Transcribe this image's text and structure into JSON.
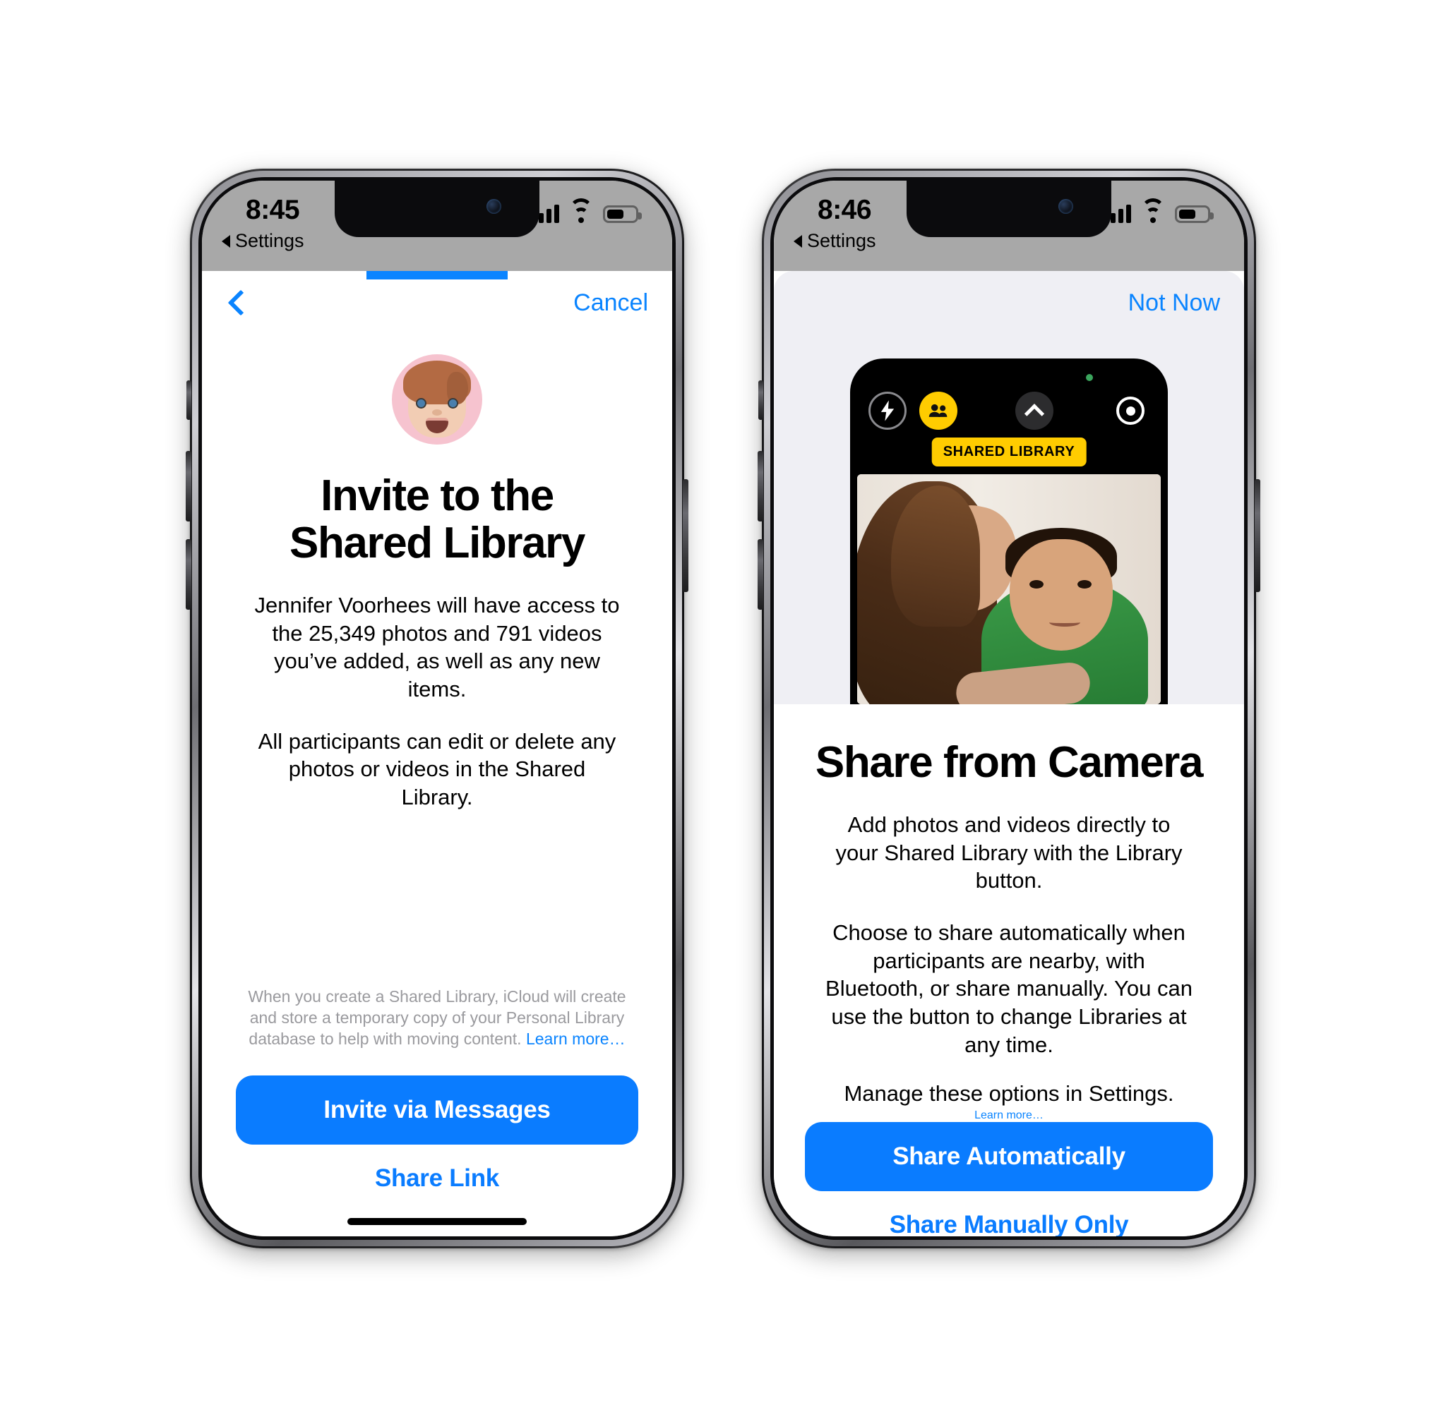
{
  "left_phone": {
    "status_bar": {
      "time": "8:45",
      "back_label": "Settings",
      "signal_icon": "cellular-signal-icon",
      "wifi_icon": "wifi-icon",
      "battery_icon": "battery-icon"
    },
    "nav": {
      "back_icon": "chevron-left-icon",
      "cancel_label": "Cancel"
    },
    "avatar": {
      "name": "memoji-avatar",
      "background_color": "#f6c3cf"
    },
    "title": "Invite to the\nShared Library",
    "title_line1": "Invite to the",
    "title_line2": "Shared Library",
    "paragraph_1": "Jennifer Voorhees will have access to the 25,349 photos and 791 videos you’ve added, as well as any new items.",
    "paragraph_2": "All participants can edit or delete any photos or videos in the Shared Library.",
    "disclaimer": "When you create a Shared Library, iCloud will create and store a temporary copy of your Personal Library database to help with moving content. ",
    "disclaimer_link": "Learn more…",
    "primary_button": "Invite via Messages",
    "secondary_button": "Share Link"
  },
  "right_phone": {
    "status_bar": {
      "time": "8:46",
      "back_label": "Settings",
      "signal_icon": "cellular-signal-icon",
      "wifi_icon": "wifi-icon",
      "battery_icon": "battery-icon"
    },
    "nav": {
      "not_now_label": "Not Now"
    },
    "camera_preview": {
      "flash_icon": "flash-bolt-icon",
      "shared_library_icon": "two-people-icon",
      "chevron_icon": "chevron-up-icon",
      "live_photo_icon": "live-photo-icon",
      "badge_label": "SHARED LIBRARY",
      "photo_description": "mother-kissing-child-photo"
    },
    "title": "Share from Camera",
    "paragraph_1": "Add photos and videos directly to your Shared Library with the Library button.",
    "paragraph_2": "Choose to share automatically when participants are nearby, with Bluetooth, or share manually. You can use the button to change Libraries at any time.",
    "paragraph_3": "Manage these options in Settings.",
    "paragraph_3_link": "Learn more…",
    "primary_button": "Share Automatically",
    "secondary_button": "Share Manually Only"
  },
  "colors": {
    "accent_blue": "#0a7cff",
    "badge_yellow": "#ffcc00",
    "disclaimer_gray": "#9a9a9e",
    "status_bar_gray": "#a8a8a8"
  }
}
